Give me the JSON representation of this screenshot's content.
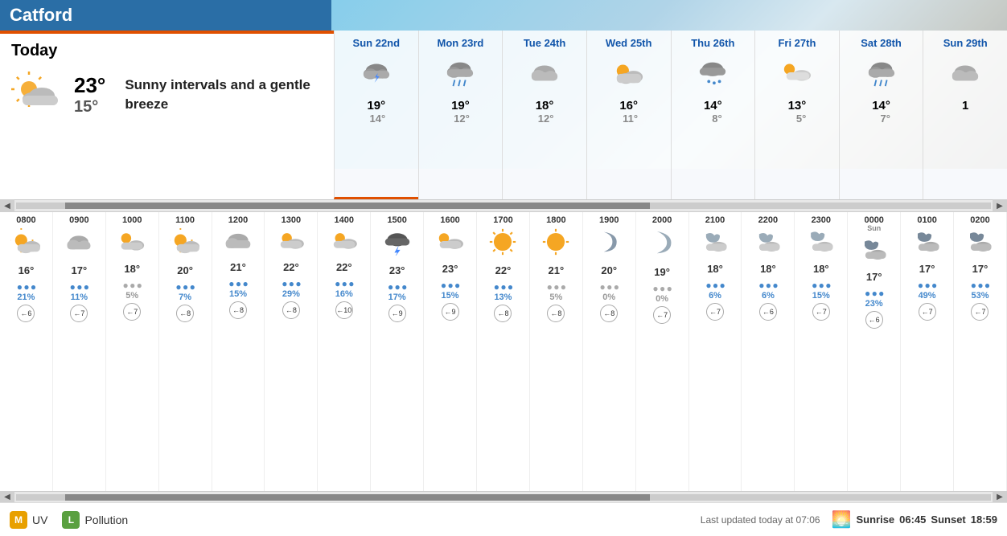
{
  "header": {
    "city": "Catford"
  },
  "today": {
    "label": "Today",
    "high": "23°",
    "low": "15°",
    "description": "Sunny intervals and a gentle breeze",
    "icon": "partly-cloudy"
  },
  "forecast_days": [
    {
      "name": "Sun 22nd",
      "icon": "thunder-cloud",
      "high": "19°",
      "low": "14°",
      "active": true
    },
    {
      "name": "Mon 23rd",
      "icon": "rain-cloud",
      "high": "19°",
      "low": "12°",
      "active": false
    },
    {
      "name": "Tue 24th",
      "icon": "cloud",
      "high": "18°",
      "low": "12°",
      "active": false
    },
    {
      "name": "Wed 25th",
      "icon": "cloud-sun",
      "high": "16°",
      "low": "11°",
      "active": false
    },
    {
      "name": "Thu 26th",
      "icon": "drizzle-cloud",
      "high": "14°",
      "low": "8°",
      "active": false
    },
    {
      "name": "Fri 27th",
      "icon": "sun-cloud",
      "high": "13°",
      "low": "5°",
      "active": false
    },
    {
      "name": "Sat 28th",
      "icon": "rain-cloud",
      "high": "14°",
      "low": "7°",
      "active": false
    },
    {
      "name": "Sun 29th",
      "icon": "cloud",
      "high": "1",
      "low": "",
      "active": false
    }
  ],
  "hourly": [
    {
      "time": "0800",
      "icon": "partly-sun",
      "temp": "16°",
      "rain_pct": "21%",
      "rain_color": "blue",
      "wind": 6,
      "wind_dir": "←"
    },
    {
      "time": "0900",
      "icon": "cloud",
      "temp": "17°",
      "rain_pct": "11%",
      "rain_color": "blue",
      "wind": 7,
      "wind_dir": "←"
    },
    {
      "time": "1000",
      "icon": "cloud-sun-sm",
      "temp": "18°",
      "rain_pct": "5%",
      "rain_color": "gray",
      "wind": 7,
      "wind_dir": "←"
    },
    {
      "time": "1100",
      "icon": "partly-sun",
      "temp": "20°",
      "rain_pct": "7%",
      "rain_color": "blue",
      "wind": 8,
      "wind_dir": "←"
    },
    {
      "time": "1200",
      "icon": "cloud-sm",
      "temp": "21°",
      "rain_pct": "15%",
      "rain_color": "blue",
      "wind": 8,
      "wind_dir": "←"
    },
    {
      "time": "1300",
      "icon": "partly-sm",
      "temp": "22°",
      "rain_pct": "29%",
      "rain_color": "blue",
      "wind": 8,
      "wind_dir": "←"
    },
    {
      "time": "1400",
      "icon": "partly-sm",
      "temp": "22°",
      "rain_pct": "16%",
      "rain_color": "blue",
      "wind": 10,
      "wind_dir": "←"
    },
    {
      "time": "1500",
      "icon": "thunder-big",
      "temp": "23°",
      "rain_pct": "17%",
      "rain_color": "blue",
      "wind": 9,
      "wind_dir": "←"
    },
    {
      "time": "1600",
      "icon": "cloud-sun-md",
      "temp": "23°",
      "rain_pct": "15%",
      "rain_color": "blue",
      "wind": 9,
      "wind_dir": "←"
    },
    {
      "time": "1700",
      "icon": "sun-big",
      "temp": "22°",
      "rain_pct": "13%",
      "rain_color": "blue",
      "wind": 8,
      "wind_dir": "←"
    },
    {
      "time": "1800",
      "icon": "sun-lg",
      "temp": "21°",
      "rain_pct": "5%",
      "rain_color": "gray",
      "wind": 8,
      "wind_dir": "←"
    },
    {
      "time": "1900",
      "icon": "moon",
      "temp": "20°",
      "rain_pct": "0%",
      "rain_color": "gray",
      "wind": 8,
      "wind_dir": "←"
    },
    {
      "time": "2000",
      "icon": "moon-lg",
      "temp": "19°",
      "rain_pct": "0%",
      "rain_color": "gray",
      "wind": 7,
      "wind_dir": "←"
    },
    {
      "time": "2100",
      "icon": "cloud-night",
      "temp": "18°",
      "rain_pct": "6%",
      "rain_color": "blue",
      "wind": 7,
      "wind_dir": "←"
    },
    {
      "time": "2200",
      "icon": "cloud-night",
      "temp": "18°",
      "rain_pct": "6%",
      "rain_color": "blue",
      "wind": 6,
      "wind_dir": "←"
    },
    {
      "time": "2300",
      "icon": "cloud-moon",
      "temp": "18°",
      "rain_pct": "15%",
      "rain_color": "blue",
      "wind": 7,
      "wind_dir": "←"
    },
    {
      "time": "0000",
      "sun": "Sun",
      "icon": "cloud-night-sm",
      "temp": "17°",
      "rain_pct": "23%",
      "rain_color": "blue",
      "wind": 6,
      "wind_dir": "←"
    },
    {
      "time": "0100",
      "icon": "cloud-night-sm2",
      "temp": "17°",
      "rain_pct": "49%",
      "rain_color": "blue",
      "wind": 7,
      "wind_dir": "←"
    },
    {
      "time": "0200",
      "icon": "cloud-night-sm3",
      "temp": "17°",
      "rain_pct": "53%",
      "rain_color": "blue",
      "wind": 7,
      "wind_dir": "←"
    }
  ],
  "bottom": {
    "uv_label": "UV",
    "uv_badge": "M",
    "pollution_label": "Pollution",
    "pollution_badge": "L",
    "last_updated": "Last updated today at 07:06",
    "sunrise_label": "Sunrise",
    "sunrise_time": "06:45",
    "sunset_label": "Sunset",
    "sunset_time": "18:59"
  }
}
